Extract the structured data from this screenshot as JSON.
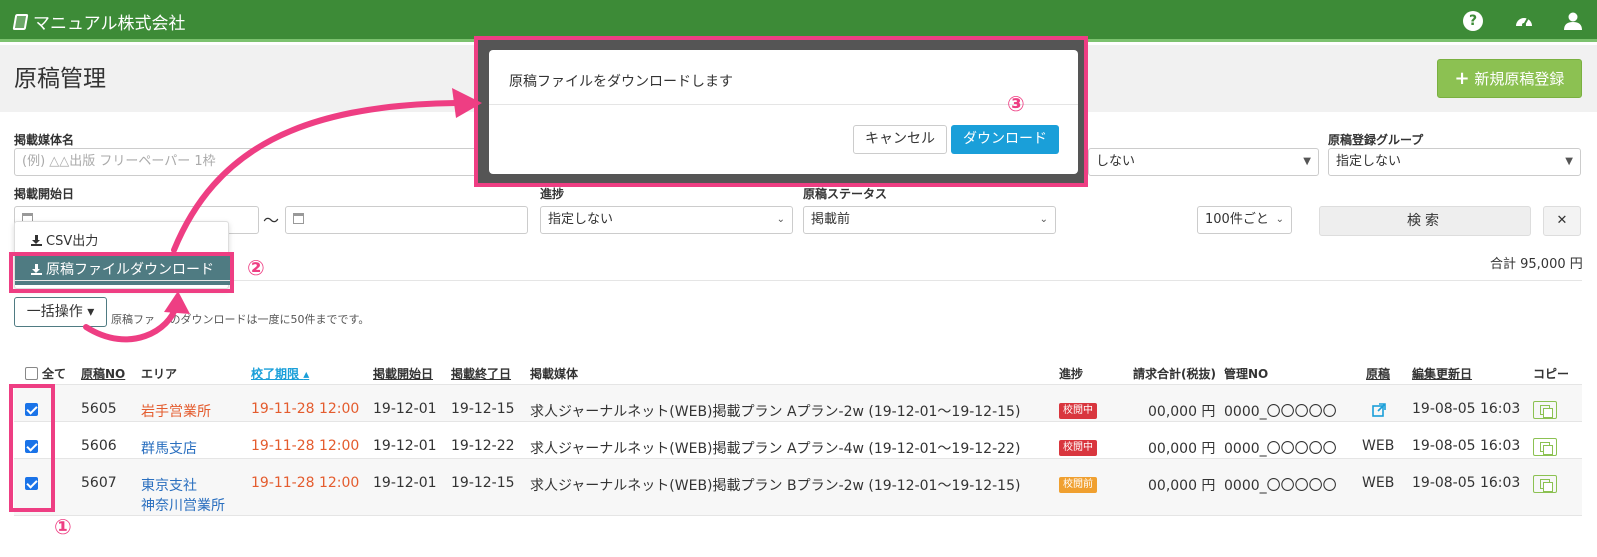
{
  "app": {
    "brand": "マニュアル株式会社"
  },
  "header": {
    "help_icon": "question-circle-icon",
    "dashboard_icon": "tachometer-icon",
    "user_icon": "user-icon"
  },
  "page": {
    "title": "原稿管理",
    "new_button": "新規原稿登録",
    "new_button_icon": "+"
  },
  "filters": {
    "media_label": "掲載媒体名",
    "media_placeholder": "(例) △△出版 フリーペーパー 1枠",
    "group_label": "原稿登録グループ",
    "group_value": "指定しない",
    "hidden_select_value": "しない",
    "start_label": "掲載開始日",
    "tilde": "〜",
    "progress_label": "進捗",
    "progress_value": "指定しない",
    "status_label": "原稿ステータス",
    "status_value": "掲載前",
    "per_page": "100件ごと",
    "search_button": "検索",
    "clear_button": "✕"
  },
  "dropdown": {
    "csv": "CSV出力",
    "download": "原稿ファイルダウンロード"
  },
  "summary": {
    "total": "合計 95,000 円"
  },
  "bulk": {
    "button": "一括操作",
    "note_prefix": "原稿ファ",
    "note_suffix": "のダウンロードは一度に50件までです。"
  },
  "table": {
    "headers": {
      "select_all": "全て",
      "no": "原稿NO",
      "area": "エリア",
      "deadline": "校了期限",
      "start": "掲載開始日",
      "end": "掲載終了日",
      "media": "掲載媒体",
      "progress": "進捗",
      "amount": "請求合計(税抜)",
      "manage_no": "管理NO",
      "manuscript": "原稿",
      "updated": "編集更新日",
      "copy": "コピー"
    },
    "rows": [
      {
        "checked": true,
        "no": "5605",
        "area": "岩手営業所",
        "area2": "",
        "deadline": "19-11-28 12:00",
        "start": "19-12-01",
        "end": "19-12-15",
        "media": "求人ジャーナルネット(WEB)掲載プラン Aプラン-2w (19-12-01〜19-12-15)",
        "badge": "校閲中",
        "amount": "00,000 円",
        "manage_no": "0000_〇〇〇〇〇",
        "manuscript": "",
        "updated": "19-08-05 16:03"
      },
      {
        "checked": true,
        "no": "5606",
        "area": "群馬支店",
        "area2": "",
        "deadline": "19-11-28 12:00",
        "start": "19-12-01",
        "end": "19-12-22",
        "media": "求人ジャーナルネット(WEB)掲載プラン Aプラン-4w (19-12-01〜19-12-22)",
        "badge": "校閲中",
        "amount": "00,000 円",
        "manage_no": "0000_〇〇〇〇〇",
        "manuscript": "WEB",
        "updated": "19-08-05 16:03"
      },
      {
        "checked": true,
        "no": "5607",
        "area": "東京支社",
        "area2": "神奈川営業所",
        "deadline": "19-11-28 12:00",
        "start": "19-12-01",
        "end": "19-12-15",
        "media": "求人ジャーナルネット(WEB)掲載プラン Bプラン-2w (19-12-01〜19-12-15)",
        "badge": "校閲前",
        "amount": "00,000 円",
        "manage_no": "0000_〇〇〇〇〇",
        "manuscript": "WEB",
        "updated": "19-08-05 16:03"
      }
    ]
  },
  "modal": {
    "message": "原稿ファイルをダウンロードします",
    "cancel": "キャンセル",
    "download": "ダウンロード"
  },
  "annotations": {
    "step1": "①",
    "step2": "②",
    "step3": "③"
  },
  "colors": {
    "header_green": "#3d8b37",
    "accent_pink": "#ee3e83",
    "primary_blue": "#1a9fd9",
    "badge_red": "#d9363e",
    "badge_orange": "#f0a030"
  }
}
